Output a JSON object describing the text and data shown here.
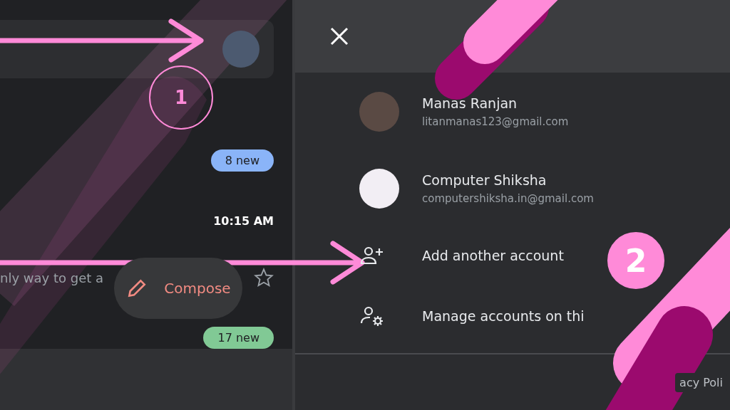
{
  "inbox": {
    "rows": [
      {
        "kind": "badge",
        "text": "8 new",
        "color": "#8ab4f8"
      },
      {
        "kind": "time",
        "text": "10:15 AM"
      },
      {
        "kind": "snippet",
        "text": "nly way to get a",
        "starred": false
      },
      {
        "kind": "badge",
        "text": "17 new",
        "color": "#81c995"
      }
    ],
    "compose_button": "Compose"
  },
  "account_menu": {
    "accounts": [
      {
        "name": "Manas Ranjan",
        "email": "litanmanas123@gmail.com"
      },
      {
        "name": "Computer Shiksha",
        "email": "computershiksha.in@gmail.com"
      }
    ],
    "actions": [
      {
        "kind": "add",
        "label": "Add another account"
      },
      {
        "kind": "manage",
        "label": "Manage accounts on thi"
      }
    ],
    "footer_link": "acy Poli"
  },
  "annotations": [
    {
      "label": "1"
    },
    {
      "label": "2"
    }
  ]
}
